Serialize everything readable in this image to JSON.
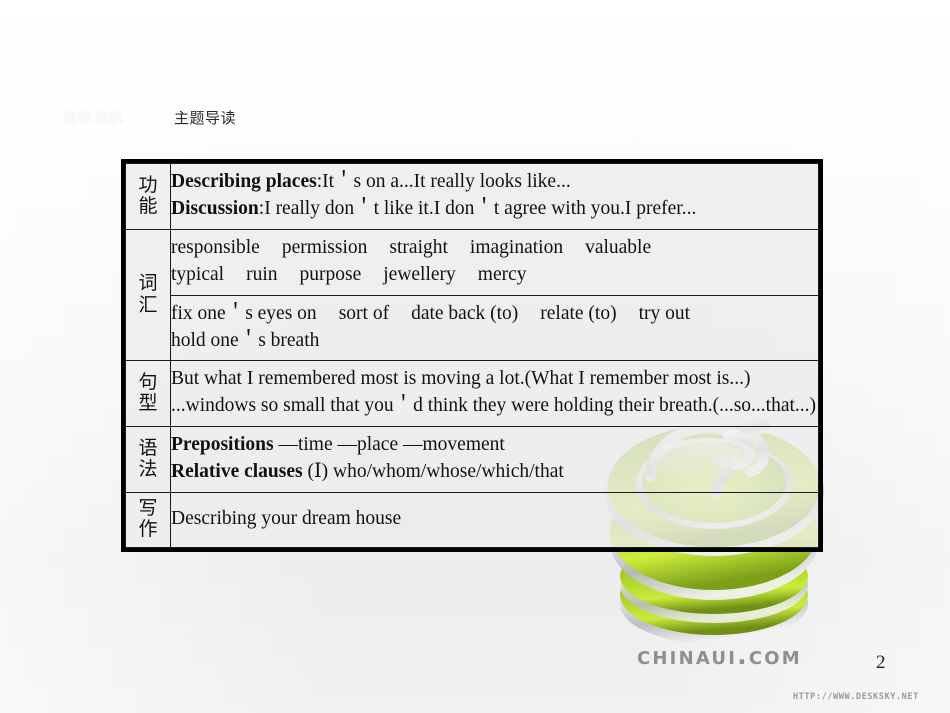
{
  "nav": {
    "inactive_tab": "课标导航",
    "active_tab": "主题导读"
  },
  "table": {
    "rows": [
      {
        "label": "功能",
        "lines": [
          {
            "bold": "Describing places",
            "rest": ":It＇s on a...It really looks like..."
          },
          {
            "bold": "Discussion",
            "rest": ":I really don＇t like it.I don＇t agree with you.I prefer..."
          }
        ]
      },
      {
        "label": "词汇",
        "words_line1": [
          "responsible",
          "permission",
          "straight",
          "imagination",
          "valuable"
        ],
        "words_line2": [
          "typical",
          "ruin",
          "purpose",
          "jewellery",
          "mercy"
        ],
        "phrases": [
          "fix one＇s eyes on",
          "sort of",
          "date back (to)",
          "relate (to)",
          "try out",
          "hold one＇s breath"
        ]
      },
      {
        "label": "句型",
        "lines": [
          "But what I remembered most is moving a lot.(What I remember most is...)",
          "...windows so small that you＇d think they were holding their breath.(...so...that...)"
        ]
      },
      {
        "label": "语法",
        "lines": [
          {
            "bold": "Prepositions",
            "rest": " —time —place —movement"
          },
          {
            "bold": "Relative clauses",
            "rest": " (Ⅰ) who/whom/whose/which/that"
          }
        ]
      },
      {
        "label": "写作",
        "lines": [
          "Describing your dream house"
        ]
      }
    ]
  },
  "footer": {
    "watermark": "CHINAUI.COM",
    "page_number": "2",
    "source_url": "HTTP://WWW.DESKSKY.NET"
  },
  "colors": {
    "border": "#000000",
    "cell_bg": "#ececec",
    "accent_green": "#9acd32",
    "text": "#111111"
  }
}
